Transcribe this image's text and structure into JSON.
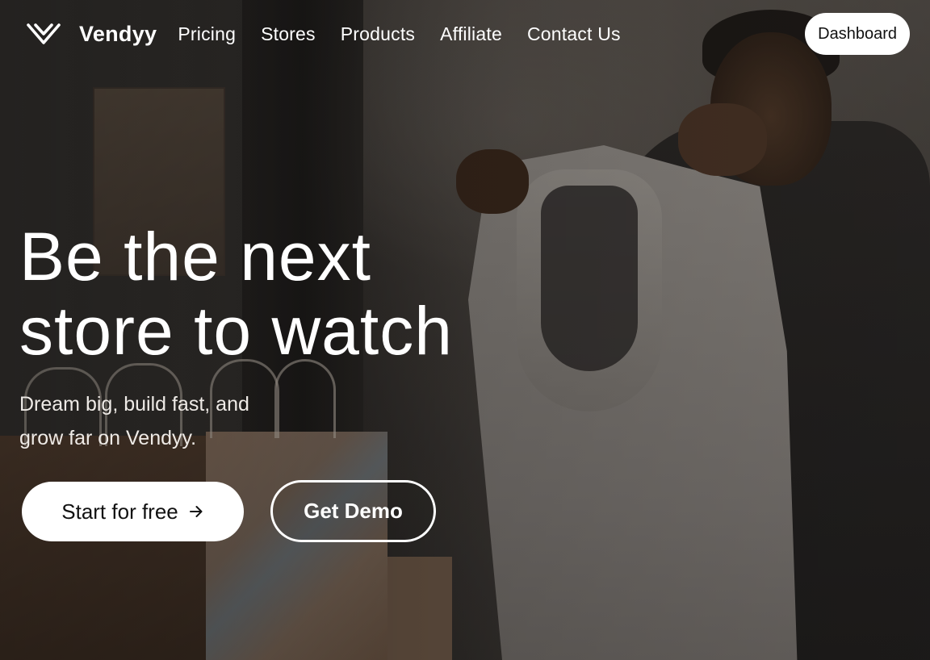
{
  "brand": {
    "name": "Vendyy",
    "logo_icon": "double-chevron-v-icon"
  },
  "nav": {
    "links": [
      {
        "label": "Pricing"
      },
      {
        "label": "Stores"
      },
      {
        "label": "Products"
      },
      {
        "label": "Affiliate"
      },
      {
        "label": "Contact Us"
      }
    ],
    "dashboard_label": "Dashboard"
  },
  "hero": {
    "headline_line1": "Be the next",
    "headline_line2": "store to watch",
    "subhead_line1": "Dream big, build fast, and",
    "subhead_line2": "grow far on Vendyy.",
    "primary_cta": "Start for free",
    "primary_cta_icon": "arrow-right-icon",
    "secondary_cta": "Get Demo",
    "background_image": "person-holding-sweater-photo"
  },
  "colors": {
    "text_primary": "#ffffff",
    "button_bg": "#ffffff",
    "button_text": "#111111"
  }
}
